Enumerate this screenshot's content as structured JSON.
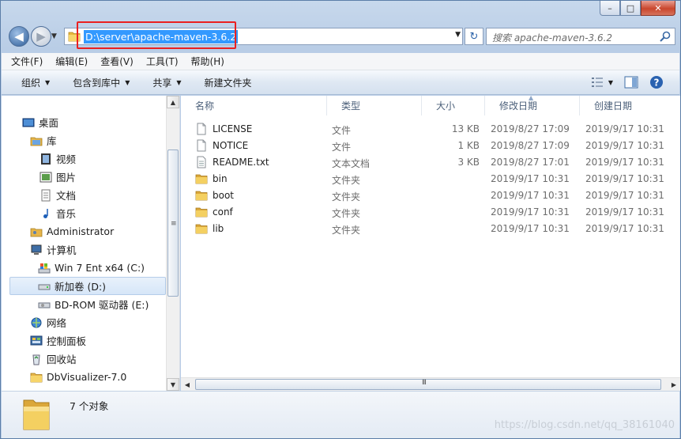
{
  "window": {
    "caption": {
      "minimize": "–",
      "maximize": "□",
      "close": "✕"
    }
  },
  "navbar": {
    "back": "◀",
    "forward": "▶",
    "history_dropdown": "▼",
    "address": "D:\\server\\apache-maven-3.6.2",
    "address_dropdown": "▼",
    "refresh": "↻",
    "search_placeholder": "搜索 apache-maven-3.6.2"
  },
  "menubar": {
    "items": [
      "文件(F)",
      "编辑(E)",
      "查看(V)",
      "工具(T)",
      "帮助(H)"
    ]
  },
  "toolbar": {
    "organize": "组织",
    "include_in_library": "包含到库中",
    "share": "共享",
    "new_folder": "新建文件夹",
    "caret": "▼"
  },
  "navpane": {
    "items": [
      {
        "label": "桌面",
        "icon": "desktop-icon"
      },
      {
        "label": "库",
        "icon": "library-icon"
      },
      {
        "label": "视频",
        "icon": "video-icon"
      },
      {
        "label": "图片",
        "icon": "picture-icon"
      },
      {
        "label": "文档",
        "icon": "document-icon"
      },
      {
        "label": "音乐",
        "icon": "music-icon"
      },
      {
        "label": "Administrator",
        "icon": "user-folder-icon"
      },
      {
        "label": "计算机",
        "icon": "computer-icon"
      },
      {
        "label": "Win 7 Ent x64 (C:)",
        "icon": "system-drive-icon"
      },
      {
        "label": "新加卷 (D:)",
        "icon": "drive-icon"
      },
      {
        "label": "BD-ROM 驱动器 (E:)",
        "icon": "optical-drive-icon"
      },
      {
        "label": "网络",
        "icon": "network-icon"
      },
      {
        "label": "控制面板",
        "icon": "control-panel-icon"
      },
      {
        "label": "回收站",
        "icon": "recycle-bin-icon"
      },
      {
        "label": "DbVisualizer-7.0",
        "icon": "folder-icon"
      }
    ],
    "selected": "新加卷 (D:)",
    "scroll_up": "▲",
    "scroll_down": "▼",
    "scroll_grip": "≡"
  },
  "filelist": {
    "columns": [
      "名称",
      "类型",
      "大小",
      "修改日期",
      "创建日期"
    ],
    "sort_indicator": "▲",
    "rows": [
      {
        "name": "LICENSE",
        "type": "文件",
        "size": "13 KB",
        "modified": "2019/8/27 17:09",
        "created": "2019/9/17 10:31",
        "icon": "file-icon"
      },
      {
        "name": "NOTICE",
        "type": "文件",
        "size": "1 KB",
        "modified": "2019/8/27 17:09",
        "created": "2019/9/17 10:31",
        "icon": "file-icon"
      },
      {
        "name": "README.txt",
        "type": "文本文档",
        "size": "3 KB",
        "modified": "2019/8/27 17:01",
        "created": "2019/9/17 10:31",
        "icon": "text-file-icon"
      },
      {
        "name": "bin",
        "type": "文件夹",
        "size": "",
        "modified": "2019/9/17 10:31",
        "created": "2019/9/17 10:31",
        "icon": "folder-icon"
      },
      {
        "name": "boot",
        "type": "文件夹",
        "size": "",
        "modified": "2019/9/17 10:31",
        "created": "2019/9/17 10:31",
        "icon": "folder-icon"
      },
      {
        "name": "conf",
        "type": "文件夹",
        "size": "",
        "modified": "2019/9/17 10:31",
        "created": "2019/9/17 10:31",
        "icon": "folder-icon"
      },
      {
        "name": "lib",
        "type": "文件夹",
        "size": "",
        "modified": "2019/9/17 10:31",
        "created": "2019/9/17 10:31",
        "icon": "folder-icon"
      }
    ],
    "hscroll_left": "◀",
    "hscroll_right": "▶",
    "hscroll_grip": "III"
  },
  "details": {
    "count_text": "7 个对象"
  },
  "watermark": "https://blog.csdn.net/qq_38161040",
  "colors": {
    "selection_blue": "#3399ff",
    "highlight_red": "#ea2020",
    "folder_yellow": "#f2c94c"
  }
}
